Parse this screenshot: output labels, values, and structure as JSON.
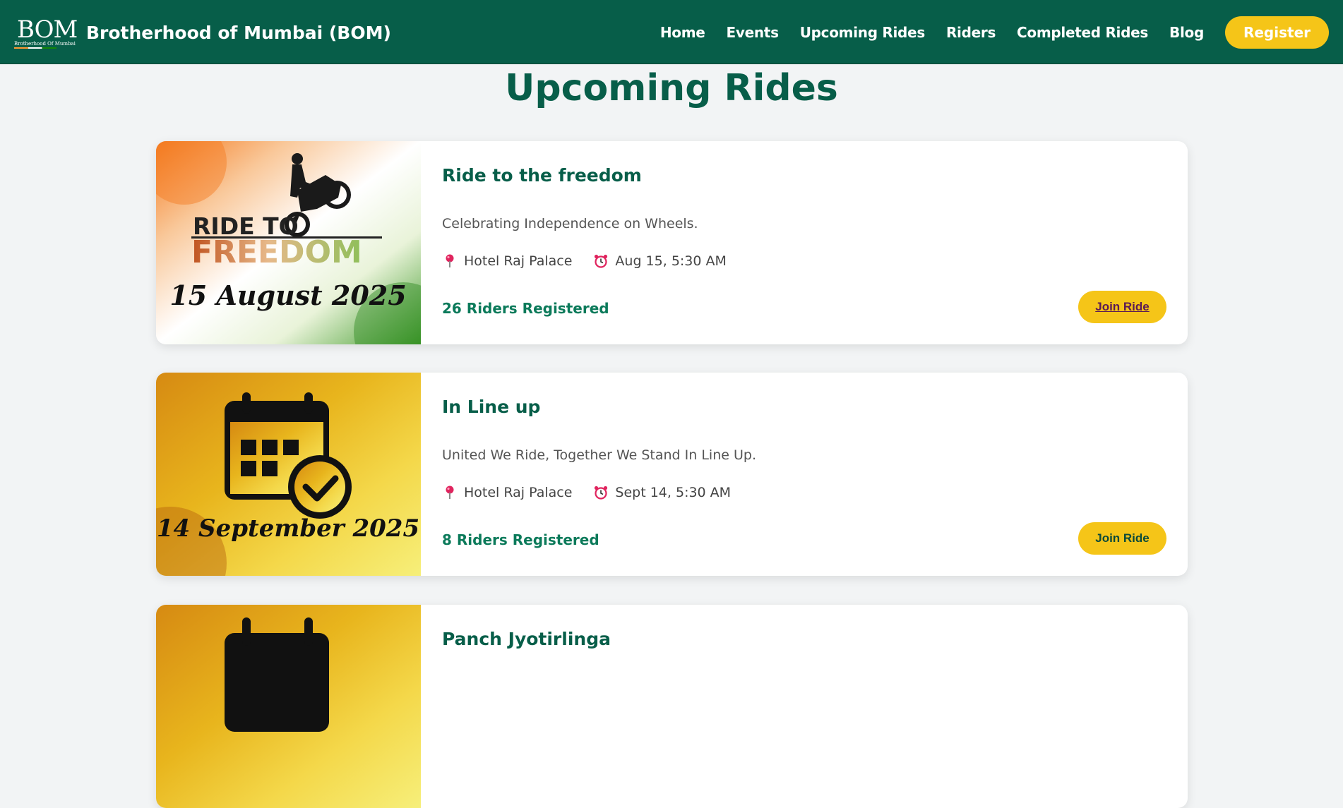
{
  "header": {
    "logo_text": "BOM",
    "logo_subtext": "Brotherhood Of Mumbai",
    "title": "Brotherhood of Mumbai (BOM)",
    "nav": [
      "Home",
      "Events",
      "Upcoming Rides",
      "Riders",
      "Completed Rides",
      "Blog"
    ],
    "register_label": "Register"
  },
  "page": {
    "title": "Upcoming Rides"
  },
  "rides": [
    {
      "title": "Ride to the freedom",
      "description": "Celebrating Independence on Wheels.",
      "location": "Hotel Raj Palace",
      "datetime": "Aug 15, 5:30 AM",
      "riders": "26 Riders Registered",
      "join_label": "Join Ride",
      "poster": {
        "line1": "RIDE TO",
        "line2": "FREEDOM",
        "date": "15 August 2025"
      }
    },
    {
      "title": "In Line up",
      "description": "United We Ride, Together We Stand In Line Up.",
      "location": "Hotel Raj Palace",
      "datetime": "Sept 14, 5:30 AM",
      "riders": "8 Riders Registered",
      "join_label": "Join Ride",
      "poster": {
        "date": "14 September 2025"
      }
    },
    {
      "title": "Panch Jyotirlinga"
    }
  ],
  "colors": {
    "primary": "#075e49",
    "accent": "#f5c518",
    "background": "#f2f4f5"
  }
}
